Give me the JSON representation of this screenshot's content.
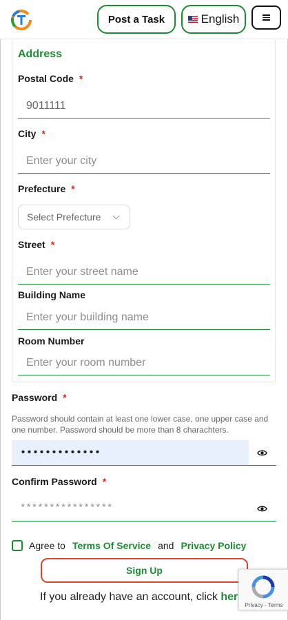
{
  "header": {
    "logo_icon": "app-logo-icon",
    "post_task_label": "Post a Task",
    "language_label": "English",
    "language_flag_icon": "us-flag-icon",
    "menu_icon": "hamburger-menu-icon"
  },
  "address": {
    "title": "Address",
    "postal_code": {
      "label": "Postal Code",
      "required": "*",
      "value": "9011111"
    },
    "city": {
      "label": "City",
      "required": "*",
      "placeholder": "Enter your city"
    },
    "prefecture": {
      "label": "Prefecture",
      "required": "*",
      "selected": "Select Prefecture"
    },
    "street": {
      "label": "Street",
      "required": "*",
      "placeholder": "Enter your street name"
    },
    "building": {
      "label": "Building Name",
      "placeholder": "Enter your building name"
    },
    "room": {
      "label": "Room Number",
      "placeholder": "Enter your room number"
    }
  },
  "password": {
    "label": "Password",
    "required": "*",
    "hint": "Password should contain at least one lower case, one upper case and one number. Password should be more than 8 charachters.",
    "value": "•••••••••••••",
    "toggle_icon": "eye-icon"
  },
  "confirm_password": {
    "label": "Confirm Password",
    "required": "*",
    "placeholder": "****************",
    "toggle_icon": "eye-icon"
  },
  "agree": {
    "prefix": "Agree to",
    "terms": "Terms Of Service",
    "and": "and",
    "privacy": "Privacy Policy"
  },
  "signup_label": "Sign Up",
  "login_prompt": {
    "text": "If you already have an account, click",
    "link": "here"
  },
  "recaptcha": {
    "icon": "recaptcha-icon",
    "links": "Privacy - Terms"
  },
  "colors": {
    "brand_green": "#1e8a36",
    "required_red": "#d9241c",
    "signup_border": "#d9462a",
    "autofill_blue": "#e8f0fe"
  }
}
